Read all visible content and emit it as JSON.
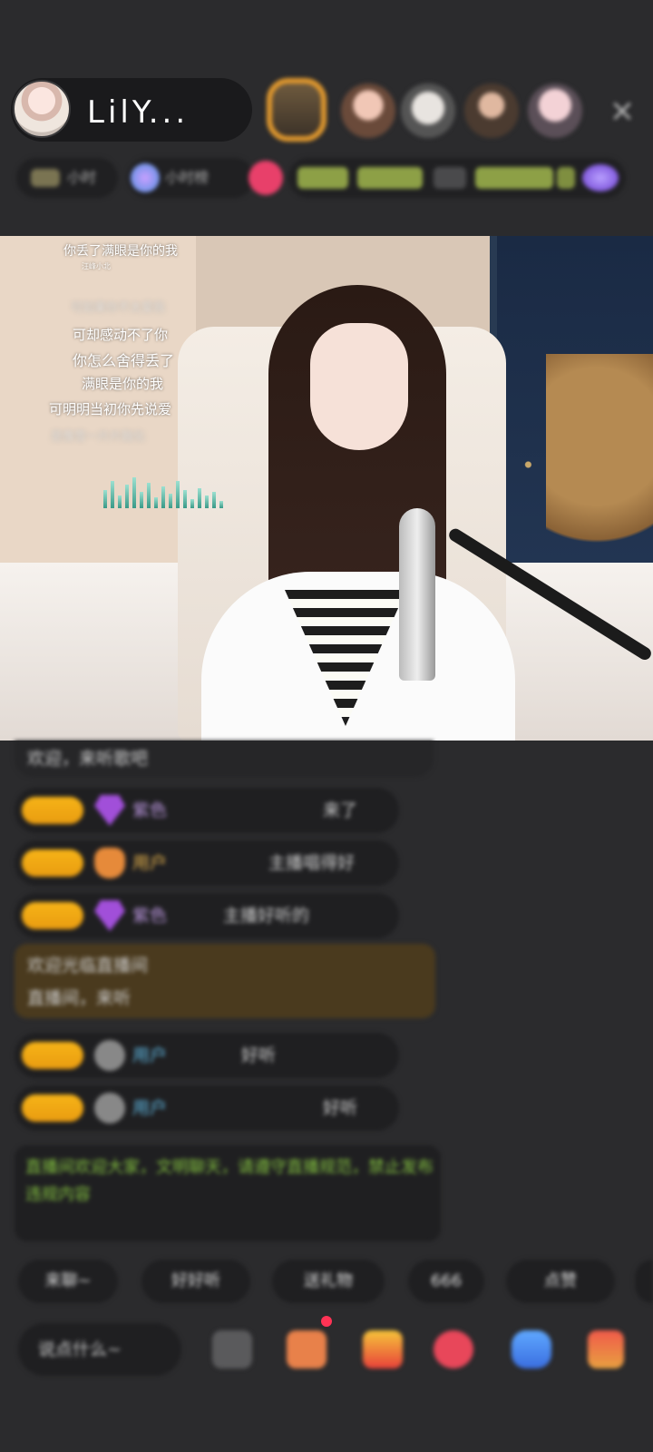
{
  "host": {
    "name": "LilY..."
  },
  "header": {
    "close_icon": "×"
  },
  "info": {
    "chip1": "小时",
    "chip2": "小时榜"
  },
  "lyrics": {
    "title": "你丢了满眼是你的我",
    "subtitle": "汪峰小北",
    "line1": "可如果你不太爱我",
    "line2": "可却感动不了你",
    "line3": "你怎么舍得丢了",
    "line4": "满眼是你的我",
    "line5": "可明明当初你先说爱",
    "line6": "是像雪一片片融化"
  },
  "chat": {
    "welcome": "欢迎，来听歌吧",
    "messages": [
      {
        "badge": "",
        "name": "紫色",
        "text": "来了"
      },
      {
        "badge": "",
        "name": "用户",
        "text": "主播唱得好"
      },
      {
        "badge": "",
        "name": "紫色",
        "text": "主播好听的"
      },
      {
        "badge": "",
        "name": "用户",
        "text": "好听"
      },
      {
        "badge": "",
        "name": "用户",
        "text": "好听"
      }
    ],
    "system_line1": "欢迎光临直播间",
    "system_line2": "直播间，来听",
    "green_notice": "直播间欢迎大家，文明聊天，请遵守直播规范，禁止发布违规内容"
  },
  "quick_replies": [
    "来聊~",
    "好好听",
    "送礼物",
    "666",
    "点赞",
    ""
  ],
  "bottom": {
    "say_placeholder": "说点什么~"
  }
}
